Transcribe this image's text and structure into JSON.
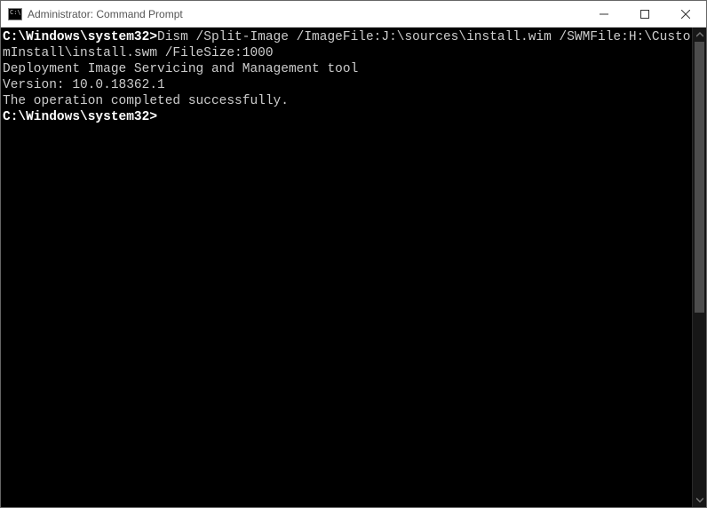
{
  "window": {
    "title": "Administrator: Command Prompt"
  },
  "terminal": {
    "blank0": "",
    "line1_prompt": "C:\\Windows\\system32>",
    "line1_cmd": "Dism /Split-Image /ImageFile:J:\\sources\\install.wim /SWMFile:H:\\CustomInstall\\install.swm /FileSize:1000",
    "blank1": "",
    "line2": "Deployment Image Servicing and Management tool",
    "line3": "Version: 10.0.18362.1",
    "blank2": "",
    "line4": "The operation completed successfully.",
    "blank3": "",
    "line5": "C:\\Windows\\system32>"
  }
}
